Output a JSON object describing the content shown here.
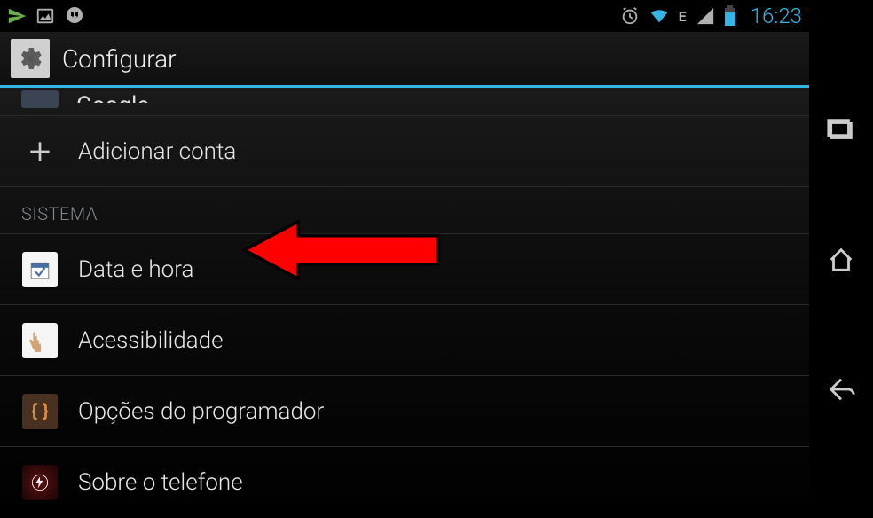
{
  "status": {
    "time": "16:23",
    "network_indicator": "E"
  },
  "header": {
    "title": "Configurar"
  },
  "partial_row": {
    "label": "Google"
  },
  "items": {
    "add_account": "Adicionar conta",
    "section_system": "SISTEMA",
    "date_time": "Data e hora",
    "accessibility": "Acessibilidade",
    "developer_options": "Opções do programador",
    "about_phone": "Sobre o telefone"
  }
}
